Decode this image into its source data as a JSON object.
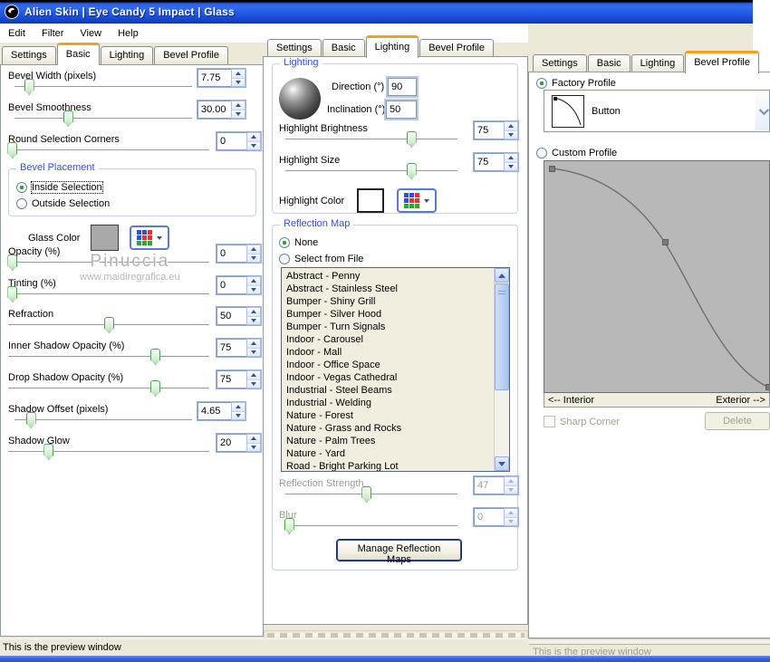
{
  "window": {
    "title": "Alien Skin | Eye Candy 5 Impact | Glass",
    "icon": "alien-skin-logo"
  },
  "menu": [
    "Edit",
    "Filter",
    "View",
    "Help"
  ],
  "tab_labels": [
    "Settings",
    "Basic",
    "Lighting",
    "Bevel Profile"
  ],
  "colors": {
    "titlebar_blue": "#1d4fdd",
    "active_tab_orange": "#eea31c",
    "group_title_blue": "#3354c8",
    "glass_color_swatch": "#a9a9a9",
    "highlight_color_swatch": "#ffffff",
    "bottom_strip_blue": "#3a68dd"
  },
  "left_panel": {
    "active_tab": "Basic",
    "sliders": [
      {
        "label": "Bevel Width (pixels)",
        "value": "7.75",
        "pos": 8,
        "wide": true
      },
      {
        "label": "Bevel Smoothness",
        "value": "30.00",
        "pos": 30,
        "wide": true
      },
      {
        "label": "Round Selection Corners",
        "value": "0",
        "pos": 2,
        "wide": false
      },
      {
        "label": "Opacity (%)",
        "value": "0",
        "pos": 2,
        "wide": false
      },
      {
        "label": "Tinting (%)",
        "value": "0",
        "pos": 2,
        "wide": false
      },
      {
        "label": "Refraction",
        "value": "50",
        "pos": 50,
        "wide": false
      },
      {
        "label": "Inner Shadow Opacity (%)",
        "value": "75",
        "pos": 73,
        "wide": false
      },
      {
        "label": "Drop Shadow Opacity (%)",
        "value": "75",
        "pos": 73,
        "wide": false
      },
      {
        "label": "Shadow Offset (pixels)",
        "value": "4.65",
        "pos": 9,
        "wide": true
      },
      {
        "label": "Shadow Glow",
        "value": "20",
        "pos": 20,
        "wide": false
      }
    ],
    "bevel_placement": {
      "title": "Bevel Placement",
      "options": [
        "Inside Selection",
        "Outside Selection"
      ],
      "selected_index": 0
    },
    "glass_color_label": "Glass Color",
    "watermark_line1": "Pinuccia",
    "watermark_line2": "www.maidiregrafica.eu"
  },
  "middle_panel": {
    "active_tab": "Lighting",
    "lighting_group": {
      "title": "Lighting",
      "direction_label": "Direction (°)",
      "direction_value": "90",
      "inclination_label": "Inclination (°)",
      "inclination_value": "50",
      "sliders": [
        {
          "label": "Highlight Brightness",
          "value": "75",
          "pos": 73
        },
        {
          "label": "Highlight Size",
          "value": "75",
          "pos": 73
        }
      ],
      "highlight_color_label": "Highlight Color"
    },
    "reflection_group": {
      "title": "Reflection Map",
      "options": [
        "None",
        "Select from File"
      ],
      "selected_index": 0,
      "list_items": [
        "Abstract - Penny",
        "Abstract - Stainless Steel",
        "Bumper - Shiny Grill",
        "Bumper - Silver Hood",
        "Bumper - Turn Signals",
        "Indoor - Carousel",
        "Indoor - Mall",
        "Indoor - Office Space",
        "Indoor - Vegas Cathedral",
        "Industrial - Steel Beams",
        "Industrial - Welding",
        "Nature - Forest",
        "Nature - Grass and Rocks",
        "Nature - Palm Trees",
        "Nature - Yard",
        "Road - Bright Parking Lot"
      ],
      "sliders": [
        {
          "label": "Reflection Strength",
          "value": "47",
          "pos": 47,
          "disabled": true
        },
        {
          "label": "Blur",
          "value": "0",
          "pos": 2,
          "disabled": true
        }
      ],
      "manage_button_label": "Manage Reflection Maps"
    }
  },
  "right_panel": {
    "active_tab": "Bevel Profile",
    "factory_profile_label": "Factory Profile",
    "factory_profile_selected": true,
    "profile_dropdown_value": "Button",
    "custom_profile_label": "Custom Profile",
    "custom_profile_selected": false,
    "curve_interior_label": "<-- Interior",
    "curve_exterior_label": "Exterior -->",
    "sharp_corner_label": "Sharp Corner",
    "sharp_corner_checked": false,
    "delete_button_label": "Delete"
  },
  "status_bar": {
    "left_text": "This is the preview window",
    "right_text": "This is the preview window"
  }
}
